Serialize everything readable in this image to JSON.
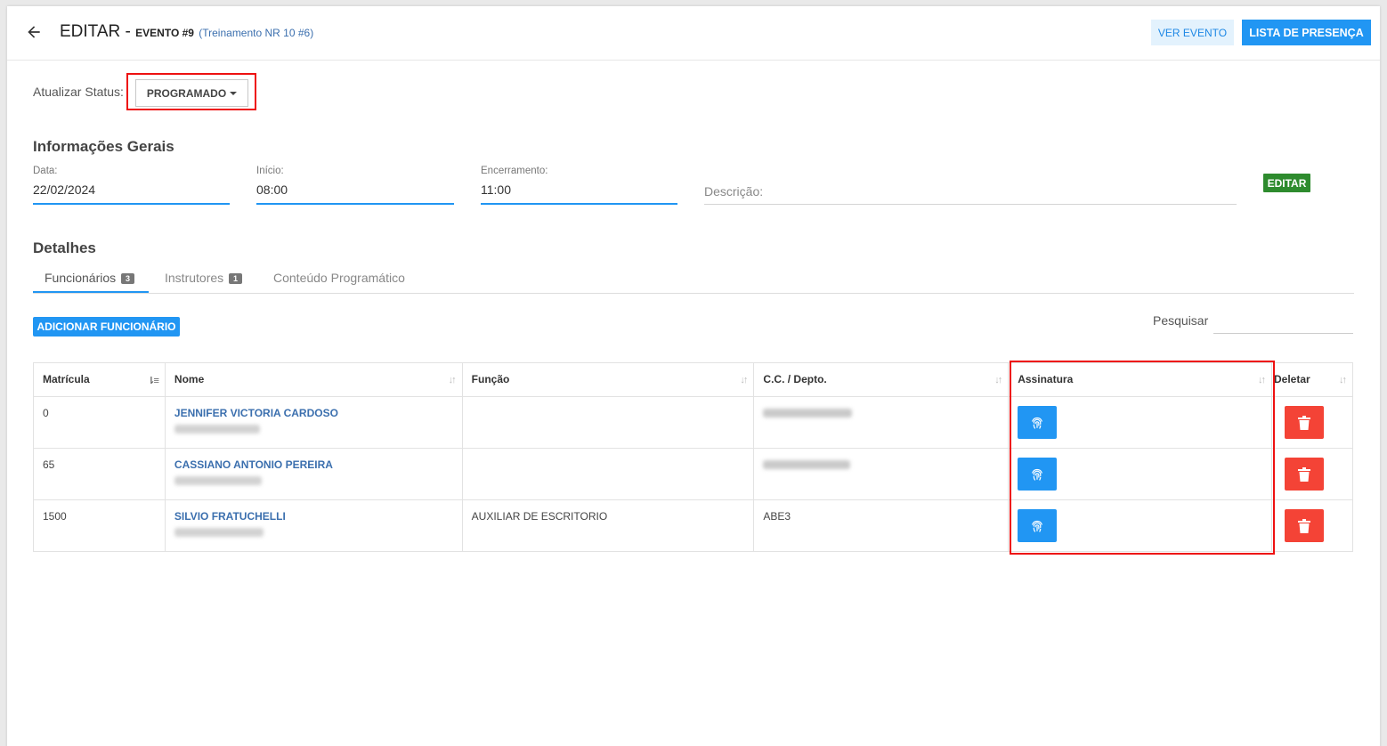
{
  "header": {
    "title": "EDITAR -",
    "event_label": "EVENTO #9",
    "training": "(Treinamento NR 10 #6)",
    "ver_evento": "VER EVENTO",
    "lista_presenca": "LISTA DE PRESENÇA"
  },
  "status": {
    "label": "Atualizar Status:",
    "value": "PROGRAMADO"
  },
  "info": {
    "heading": "Informações Gerais",
    "data_label": "Data:",
    "data_value": "22/02/2024",
    "inicio_label": "Início:",
    "inicio_value": "08:00",
    "encerramento_label": "Encerramento:",
    "encerramento_value": "11:00",
    "descricao_placeholder": "Descrição:",
    "editar": "EDITAR"
  },
  "details": {
    "heading": "Detalhes",
    "tabs": [
      {
        "label": "Funcionários",
        "count": "3"
      },
      {
        "label": "Instrutores",
        "count": "1"
      },
      {
        "label": "Conteúdo Programático"
      }
    ],
    "add_button": "ADICIONAR FUNCIONÁRIO",
    "search_label": "Pesquisar"
  },
  "table": {
    "headers": [
      "Matrícula",
      "Nome",
      "Função",
      "C.C. / Depto.",
      "Assinatura",
      "Deletar"
    ],
    "rows": [
      {
        "matricula": "0",
        "nome": "JENNIFER VICTORIA CARDOSO",
        "funcao": "",
        "cc": ""
      },
      {
        "matricula": "65",
        "nome": "CASSIANO ANTONIO PEREIRA",
        "funcao": "",
        "cc": ""
      },
      {
        "matricula": "1500",
        "nome": "SILVIO FRATUCHELLI",
        "funcao": "AUXILIAR DE ESCRITORIO",
        "cc": "ABE3"
      }
    ]
  },
  "icons": {
    "back": "arrow-left-icon",
    "signature": "fingerprint-icon",
    "delete": "trash-icon",
    "sort": "sort-icon"
  },
  "colors": {
    "primary": "#2196f3",
    "success": "#2e8b2e",
    "danger": "#f44336",
    "highlight": "#e11111"
  }
}
